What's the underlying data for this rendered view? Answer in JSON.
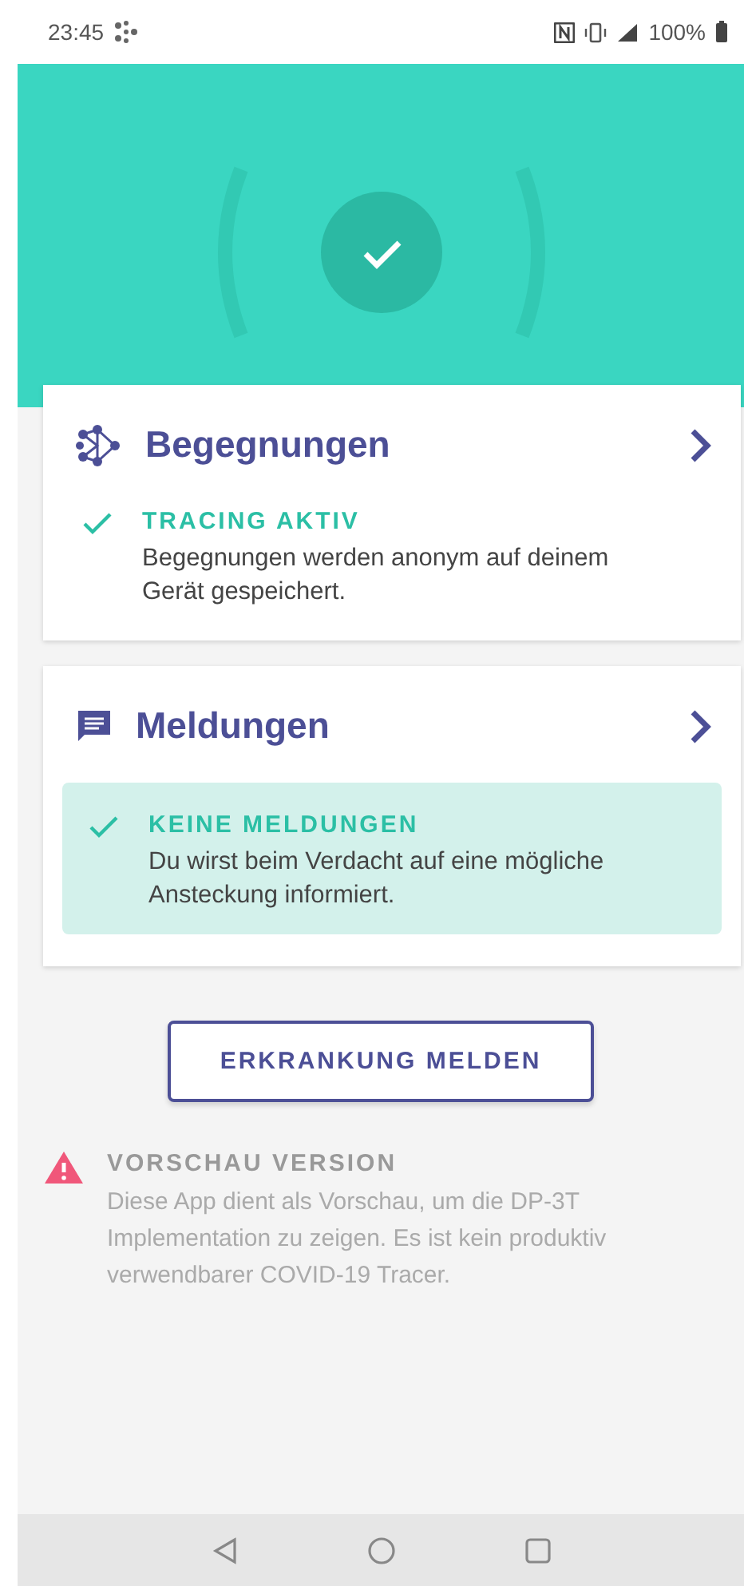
{
  "status_bar": {
    "time": "23:45",
    "battery": "100%"
  },
  "header": {
    "tracing_on": true
  },
  "cards": [
    {
      "kind": "network",
      "title": "Begegnungen",
      "status_title": "TRACING AKTIV",
      "status_text": "Begegnungen werden anonym auf deinem Gerät gespeichert.",
      "highlighted": false
    },
    {
      "kind": "message",
      "title": "Meldungen",
      "status_title": "KEINE MELDUNGEN",
      "status_text": "Du wirst beim Verdacht auf eine mögliche Ansteckung informiert.",
      "highlighted": true
    }
  ],
  "report_button": "ERKRANKUNG MELDEN",
  "warning": {
    "title": "VORSCHAU VERSION",
    "text": "Diese App dient als Vorschau, um die DP-3T Implementation zu zeigen. Es ist kein produktiv verwendbarer COVID-19 Tracer."
  }
}
